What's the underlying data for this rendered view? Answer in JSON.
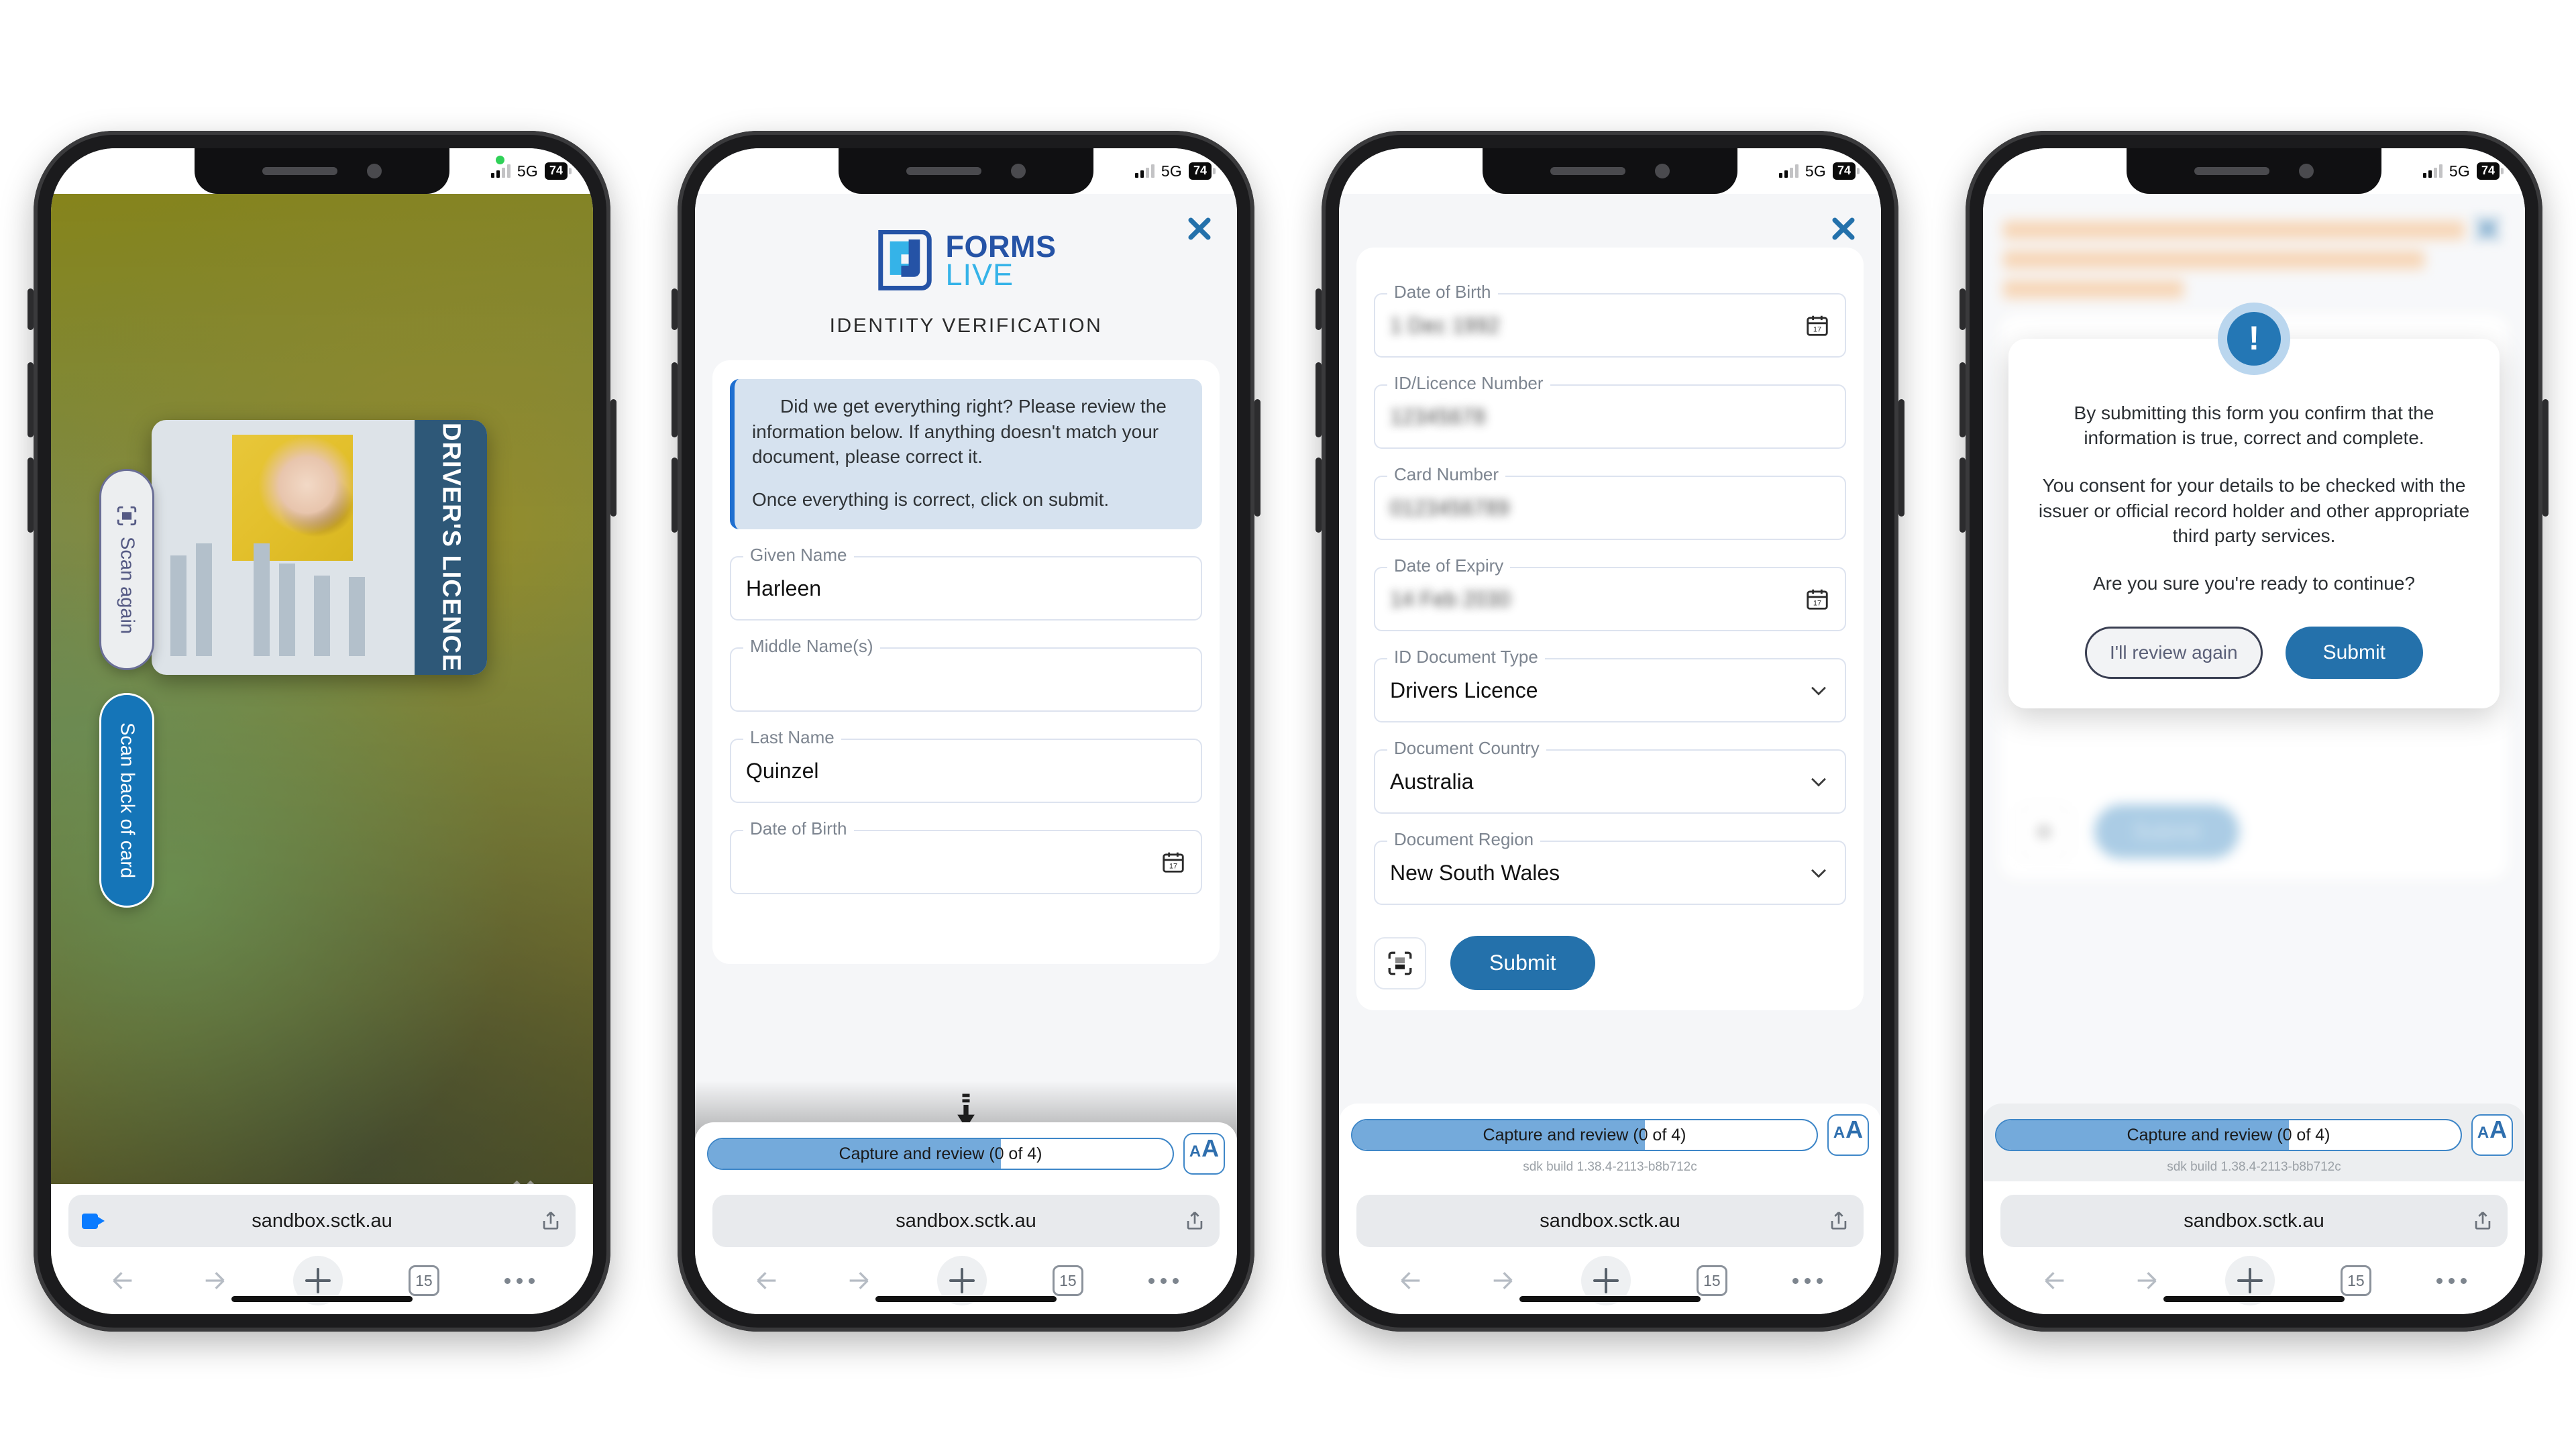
{
  "status_bar": {
    "network": "5G",
    "battery": "74"
  },
  "browser": {
    "url": "sandbox.sctk.au",
    "tab_count": "15",
    "icons": {
      "camera": "camera-icon",
      "share": "share-icon",
      "back": "back-arrow-icon",
      "forward": "forward-arrow-icon",
      "new_tab": "plus-icon",
      "more": "more-menu-icon"
    }
  },
  "sdk_bar": {
    "progress_label": "Capture and review (0 of 4)",
    "progress_percent": 63,
    "build": "sdk build 1.38.4-2113-b8b712c",
    "text_size_small": "A",
    "text_size_large": "A"
  },
  "phone1": {
    "scan_again_label": "Scan again",
    "scan_back_label": "Scan back of card",
    "card_title": "DRIVER'S LICENCE",
    "close_label": "✖",
    "build": "sdk build 1.38.4-2113-b8b712c"
  },
  "app": {
    "brand_line1": "FORMS",
    "brand_line2": "LIVE",
    "title": "IDENTITY VERIFICATION",
    "close_label": "✖"
  },
  "phone2": {
    "notice": {
      "line1": "Did we get everything right? Please review the information below. If anything doesn't match your document, please correct it.",
      "line2": "Once everything is correct, click on submit."
    },
    "fields": [
      {
        "label": "Given Name",
        "value": "Harleen",
        "blurred": false
      },
      {
        "label": "Middle Name(s)",
        "value": "",
        "blurred": false
      },
      {
        "label": "Last Name",
        "value": "Quinzel",
        "blurred": false
      },
      {
        "label": "Date of Birth",
        "value": "",
        "blurred": false
      }
    ]
  },
  "phone3": {
    "fields": [
      {
        "label": "Date of Birth",
        "value": "1 Dec 1992",
        "blurred": true,
        "control": "date"
      },
      {
        "label": "ID/Licence Number",
        "value": "12345678",
        "blurred": true,
        "control": "text"
      },
      {
        "label": "Card  Number",
        "value": "0123456789",
        "blurred": true,
        "control": "text"
      },
      {
        "label": "Date of Expiry",
        "value": "14 Feb 2030",
        "blurred": true,
        "control": "date"
      },
      {
        "label": "ID Document Type",
        "value": "Drivers  Licence",
        "blurred": false,
        "control": "select"
      },
      {
        "label": "Document Country",
        "value": "Australia",
        "blurred": false,
        "control": "select"
      },
      {
        "label": "Document Region",
        "value": "New South Wales",
        "blurred": false,
        "control": "select"
      }
    ],
    "scan_icon": "document-scan-icon",
    "submit_label": "Submit"
  },
  "phone4": {
    "modal": {
      "icon": "!",
      "p1": "By submitting this form you confirm that the information is true, correct and complete.",
      "p2": "You consent for your details to be checked with the issuer or official record holder and other appropriate third party services.",
      "p3": "Are you sure you're ready to continue?",
      "cancel_label": "I'll review again",
      "confirm_label": "Submit"
    }
  },
  "colors": {
    "primary_blue": "#2471ab",
    "brand_dark_blue": "#2553a6",
    "brand_light_blue": "#35b3e8",
    "notice_bg": "#d6e2ef",
    "notice_border": "#1f6fd0",
    "card_strip": "#2e5878"
  }
}
